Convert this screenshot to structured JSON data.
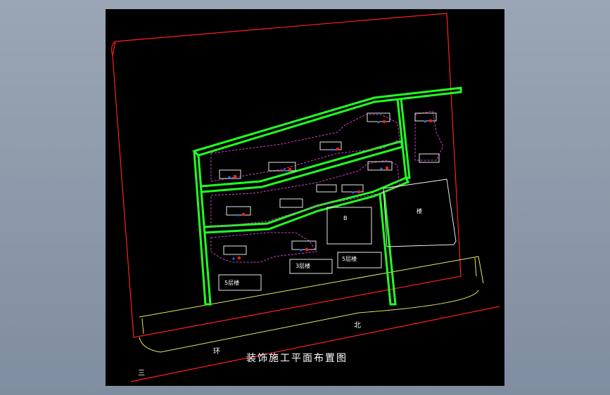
{
  "title": "装饰施工平面布置图",
  "labels": {
    "north": "北",
    "ring": "环",
    "three": "三",
    "building_5f_left": "5层楼",
    "building_5f_mid": "5层楼",
    "building_3f": "3层楼",
    "building_b": "B",
    "building_big": "楼"
  },
  "colors": {
    "background": "#000000",
    "boundary": "#ff2020",
    "road": "#22ff22",
    "fence": "#d040d0",
    "road_edge": "#e8e860",
    "buildings": "#ffffff"
  }
}
